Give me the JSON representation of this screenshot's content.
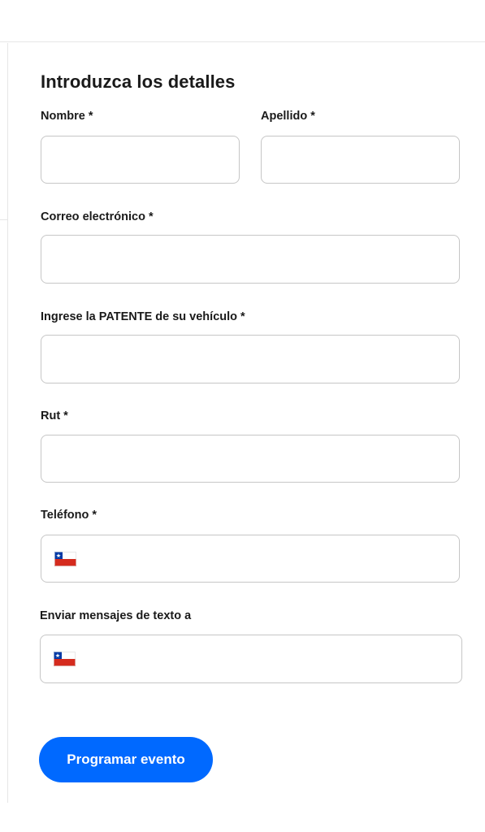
{
  "form": {
    "heading": "Introduzca los detalles",
    "first_name": {
      "label": "Nombre *",
      "value": ""
    },
    "last_name": {
      "label": "Apellido *",
      "value": ""
    },
    "email": {
      "label": "Correo electrónico *",
      "value": ""
    },
    "plate": {
      "label": "Ingrese la PATENTE de su vehículo *",
      "value": ""
    },
    "rut": {
      "label": "Rut *",
      "value": ""
    },
    "phone": {
      "label": "Teléfono *",
      "country_flag": "chile-flag-icon",
      "value": ""
    },
    "sms": {
      "label": "Enviar mensajes de texto a",
      "country_flag": "chile-flag-icon",
      "value": ""
    },
    "submit_label": "Programar evento"
  },
  "colors": {
    "accent": "#0069ff",
    "border": "#c6c6c6",
    "text": "#1a1a1a"
  }
}
